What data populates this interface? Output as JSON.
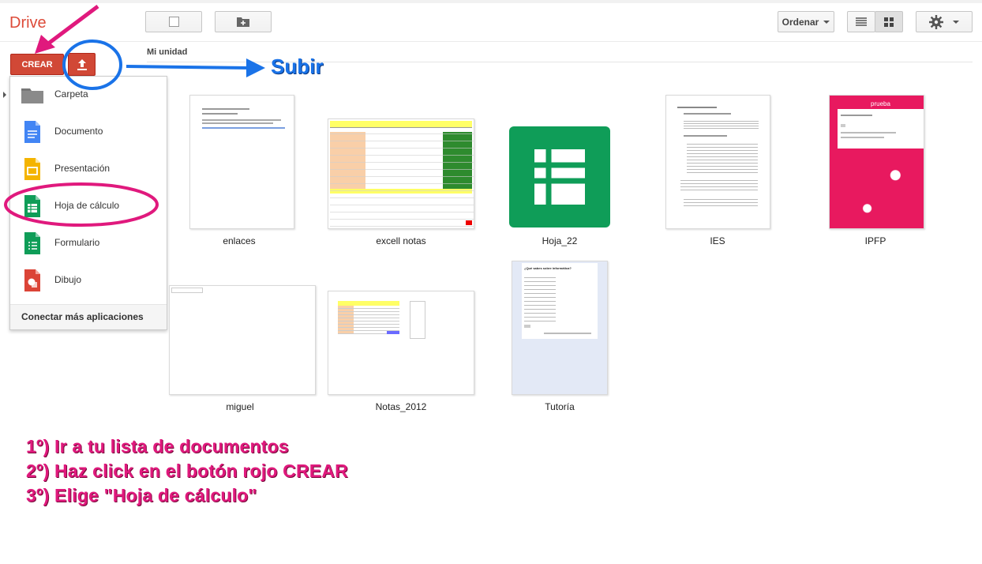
{
  "app": {
    "logo": "Drive"
  },
  "toolbar": {
    "sort_label": "Ordenar",
    "settings_icon": "gear-icon",
    "view_list_icon": "list-view-icon",
    "view_grid_icon": "grid-view-icon",
    "select_icon": "checkbox-icon",
    "new_folder_icon": "new-folder-icon"
  },
  "breadcrumb": {
    "current": "Mi unidad"
  },
  "sidebar": {
    "create_label": "CREAR",
    "upload_icon": "upload-icon",
    "menu": [
      {
        "label": "Carpeta",
        "icon": "folder-icon"
      },
      {
        "label": "Documento",
        "icon": "docs-icon"
      },
      {
        "label": "Presentación",
        "icon": "slides-icon"
      },
      {
        "label": "Hoja de cálculo",
        "icon": "sheets-icon"
      },
      {
        "label": "Formulario",
        "icon": "forms-icon"
      },
      {
        "label": "Dibujo",
        "icon": "drawing-icon"
      }
    ],
    "more_apps": "Conectar más aplicaciones"
  },
  "files": [
    {
      "name": "enlaces"
    },
    {
      "name": "excell notas"
    },
    {
      "name": "Hoja_22"
    },
    {
      "name": "IES"
    },
    {
      "name": "IPFP"
    },
    {
      "name": "miguel"
    },
    {
      "name": "Notas_2012"
    },
    {
      "name": "Tutoría"
    }
  ],
  "thumbnails": {
    "ipfp_title": "prueba",
    "tutoria_title": "¿Qué sabes sobre informática?"
  },
  "annotations": {
    "upload_callout": "Subir",
    "steps": [
      "1º) Ir a tu lista de documentos",
      "2º) Haz click en el botón rojo CREAR",
      "3º) Elige \"Hoja de cálculo\""
    ],
    "colors": {
      "pink": "#e0197d",
      "blue": "#1a73e8",
      "red": "#d14836",
      "sheets_green": "#0f9d58"
    }
  }
}
